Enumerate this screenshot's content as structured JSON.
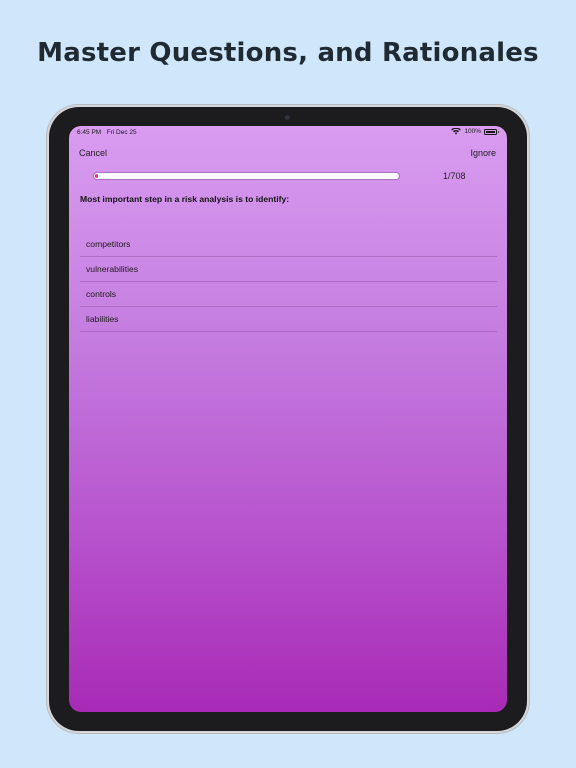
{
  "headline": "Master Questions, and Rationales",
  "status_bar": {
    "time": "6:45 PM",
    "date": "Fri Dec 25",
    "battery": "100%",
    "icons": [
      "wifi-icon",
      "battery-icon"
    ]
  },
  "nav": {
    "cancel_label": "Cancel",
    "ignore_label": "Ignore"
  },
  "progress": {
    "counter": "1/708",
    "current": 1,
    "total": 708,
    "fill_fraction": 0.0014
  },
  "question": "Most important step in a risk analysis is to identify:",
  "answers": [
    "competitors",
    "vulnerabilities",
    "controls",
    "liabilities"
  ],
  "colors": {
    "page_background": "#cfe6fb",
    "screen_gradient_top": "#d99cf1",
    "screen_gradient_bottom": "#a82ab6",
    "device_frame": "#1c1c1e",
    "progress_fill": "#e23b7a"
  }
}
